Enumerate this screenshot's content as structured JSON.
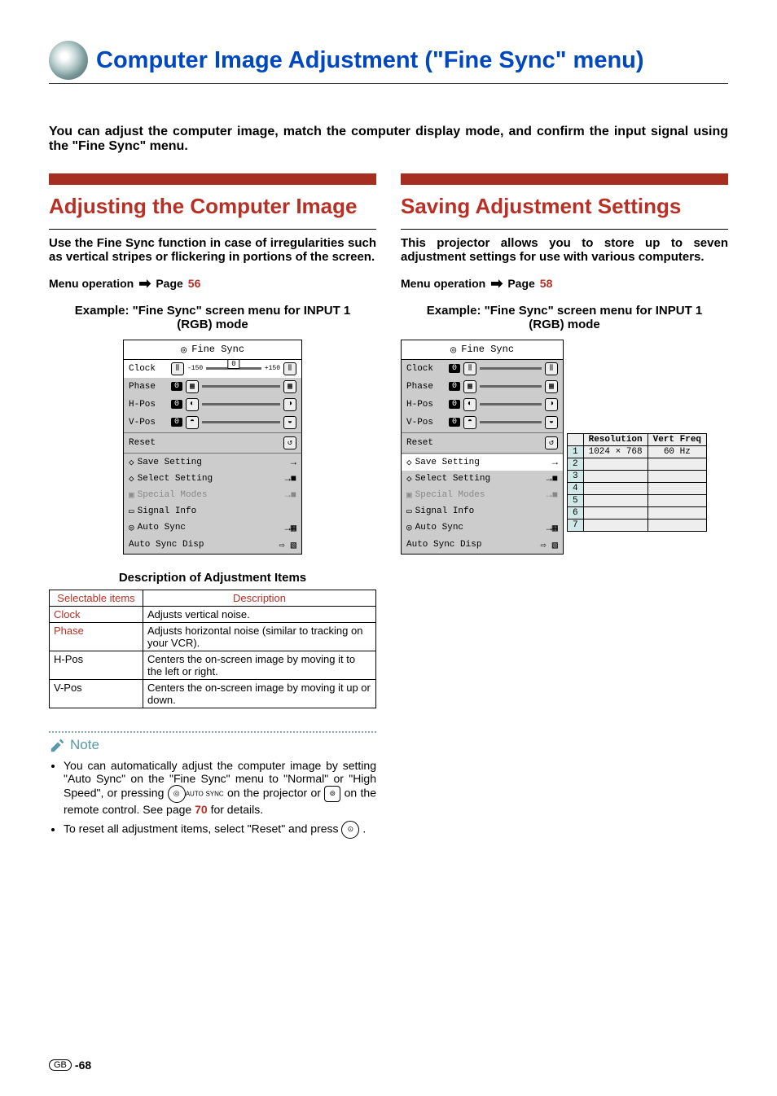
{
  "page_title": "Computer Image Adjustment (\"Fine Sync\" menu)",
  "intro": "You can adjust the computer image, match the computer display mode, and confirm the input signal using the \"Fine Sync\" menu.",
  "left": {
    "heading": "Adjusting the Computer Image",
    "lede": "Use the Fine Sync function in case of irregularities such as vertical stripes or flickering in portions of the screen.",
    "menuop": "Menu operation",
    "page_label": "Page",
    "page_num": "56",
    "example": "Example: \"Fine Sync\" screen menu for INPUT 1 (RGB) mode",
    "osd": {
      "title": "Fine Sync",
      "rows_top": [
        {
          "label": "Clock",
          "val": "0",
          "highlight": true,
          "range_lo": "-150",
          "range_hi": "+150"
        },
        {
          "label": "Phase",
          "val": "0"
        },
        {
          "label": "H-Pos",
          "val": "0"
        },
        {
          "label": "V-Pos",
          "val": "0"
        }
      ],
      "reset": "Reset",
      "rows_bottom": [
        {
          "label": "Save Setting",
          "icon": "→"
        },
        {
          "label": "Select Setting",
          "icon": "→■"
        },
        {
          "label": "Special Modes",
          "icon": "→■",
          "dim": true
        },
        {
          "label": "Signal Info",
          "icon": ""
        },
        {
          "label": "Auto Sync",
          "icon": "→▦"
        },
        {
          "label": "Auto Sync Disp",
          "icon": "⇨ ▧"
        }
      ]
    },
    "desc_heading": "Description of Adjustment Items",
    "table": {
      "h1": "Selectable items",
      "h2": "Description",
      "rows": [
        {
          "item": "Clock",
          "desc": "Adjusts vertical noise.",
          "red": true
        },
        {
          "item": "Phase",
          "desc": "Adjusts horizontal noise (similar to tracking on your VCR).",
          "red": true
        },
        {
          "item": "H-Pos",
          "desc": "Centers the on-screen image by moving it to the left or right."
        },
        {
          "item": "V-Pos",
          "desc": "Centers the on-screen image by moving it up or down."
        }
      ]
    },
    "note_label": "Note",
    "notes": [
      {
        "pre": "You can automatically adjust the computer image by setting \"Auto Sync\" on the \"Fine Sync\" menu to \"Normal\" or \"High Speed\", or pressing ",
        "mid1": " on the projector or ",
        "mid2": " on the remote control. See page ",
        "page": "70",
        "post": " for details."
      },
      {
        "pre": "To reset all adjustment items, select \"Reset\" and press ",
        "post": "."
      }
    ],
    "auto_sync_tiny": "AUTO SYNC"
  },
  "right": {
    "heading": "Saving Adjustment Settings",
    "lede": "This projector allows you to store up to seven adjustment settings for use with various computers.",
    "menuop": "Menu operation",
    "page_label": "Page",
    "page_num": "58",
    "example": "Example: \"Fine Sync\" screen menu for INPUT 1 (RGB) mode",
    "osd": {
      "title": "Fine Sync",
      "rows_top": [
        {
          "label": "Clock",
          "val": "0"
        },
        {
          "label": "Phase",
          "val": "0"
        },
        {
          "label": "H-Pos",
          "val": "0"
        },
        {
          "label": "V-Pos",
          "val": "0"
        }
      ],
      "reset": "Reset",
      "rows_bottom": [
        {
          "label": "Save Setting",
          "icon": "→",
          "hl": true
        },
        {
          "label": "Select Setting",
          "icon": "→■"
        },
        {
          "label": "Special Modes",
          "icon": "→■",
          "dim": true
        },
        {
          "label": "Signal Info",
          "icon": ""
        },
        {
          "label": "Auto Sync",
          "icon": "→▦"
        },
        {
          "label": "Auto Sync Disp",
          "icon": "⇨ ▧"
        }
      ]
    },
    "save_table": {
      "h1": "Resolution",
      "h2": "Vert Freq",
      "row1": {
        "res": "1024 × 768",
        "freq": "60 Hz"
      },
      "rows": [
        "1",
        "2",
        "3",
        "4",
        "5",
        "6",
        "7"
      ]
    }
  },
  "footer": {
    "gb": "GB",
    "num": "-68"
  }
}
